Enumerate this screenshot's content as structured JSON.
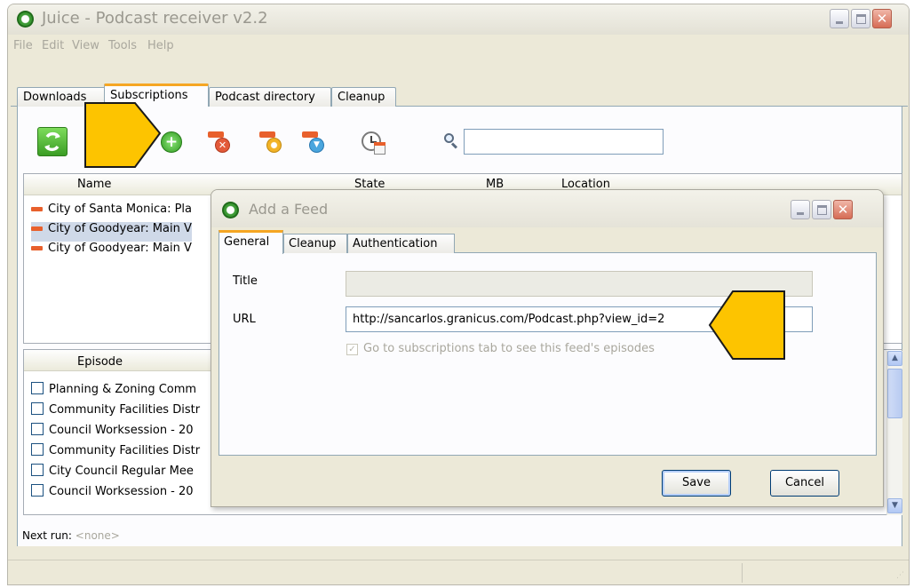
{
  "window": {
    "title": "Juice - Podcast receiver v2.2",
    "menu": [
      "File",
      "Edit",
      "View",
      "Tools",
      "Help"
    ]
  },
  "tabs": [
    "Downloads",
    "Subscriptions",
    "Podcast directory",
    "Cleanup"
  ],
  "subscriptions": {
    "columns": [
      "Name",
      "State",
      "MB",
      "Location"
    ],
    "rows": [
      "City of Santa Monica: Pla",
      "City of Goodyear: Main V",
      "City of Goodyear: Main V"
    ]
  },
  "episodes": {
    "column": "Episode",
    "rows": [
      "Planning & Zoning Comm",
      "Community Facilities Distr",
      "Council Worksession - 20",
      "Community Facilities Distr",
      "City Council Regular Mee",
      "Council Worksession - 20"
    ]
  },
  "next_run": {
    "label": "Next run:",
    "value": "<none>"
  },
  "dialog": {
    "title": "Add a Feed",
    "tabs": [
      "General",
      "Cleanup",
      "Authentication"
    ],
    "title_label": "Title",
    "title_value": "",
    "url_label": "URL",
    "url_value": "http://sancarlos.granicus.com/Podcast.php?view_id=2",
    "checkbox_label": "Go to subscriptions tab to see this feed's episodes",
    "save_label": "Save",
    "cancel_label": "Cancel"
  },
  "icons": {
    "refresh": "refresh-icon",
    "add_feed": "add-feed-icon",
    "delete_feed": "delete-feed-icon",
    "feed_settings": "feed-settings-icon",
    "feed_down": "feed-download-icon",
    "scheduler": "scheduler-icon",
    "search": "search-icon"
  },
  "colors": {
    "callout": "#fdc400",
    "feed_orange": "#e8602c",
    "tab_highlight": "#f5a623"
  }
}
